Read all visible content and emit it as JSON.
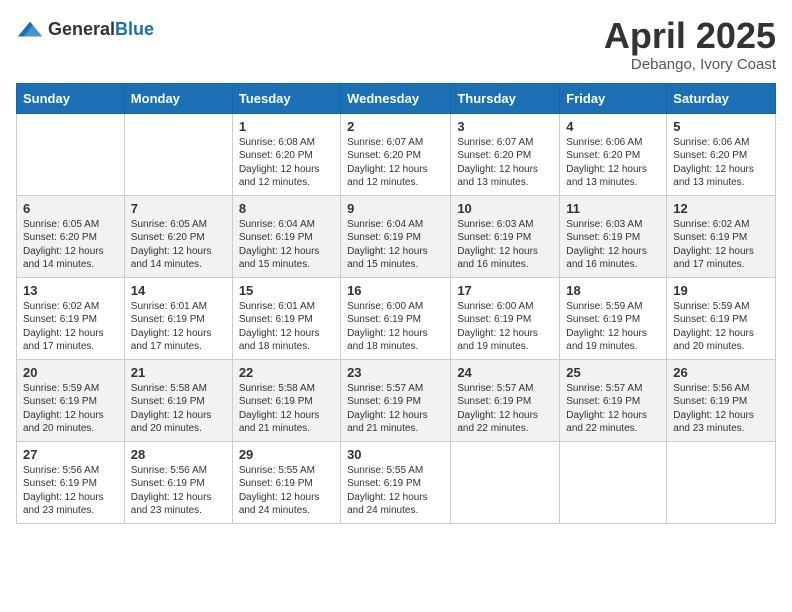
{
  "logo": {
    "general": "General",
    "blue": "Blue"
  },
  "title": "April 2025",
  "location": "Debango, Ivory Coast",
  "days_header": [
    "Sunday",
    "Monday",
    "Tuesday",
    "Wednesday",
    "Thursday",
    "Friday",
    "Saturday"
  ],
  "weeks": [
    [
      {
        "day": "",
        "info": ""
      },
      {
        "day": "",
        "info": ""
      },
      {
        "day": "1",
        "info": "Sunrise: 6:08 AM\nSunset: 6:20 PM\nDaylight: 12 hours and 12 minutes."
      },
      {
        "day": "2",
        "info": "Sunrise: 6:07 AM\nSunset: 6:20 PM\nDaylight: 12 hours and 12 minutes."
      },
      {
        "day": "3",
        "info": "Sunrise: 6:07 AM\nSunset: 6:20 PM\nDaylight: 12 hours and 13 minutes."
      },
      {
        "day": "4",
        "info": "Sunrise: 6:06 AM\nSunset: 6:20 PM\nDaylight: 12 hours and 13 minutes."
      },
      {
        "day": "5",
        "info": "Sunrise: 6:06 AM\nSunset: 6:20 PM\nDaylight: 12 hours and 13 minutes."
      }
    ],
    [
      {
        "day": "6",
        "info": "Sunrise: 6:05 AM\nSunset: 6:20 PM\nDaylight: 12 hours and 14 minutes."
      },
      {
        "day": "7",
        "info": "Sunrise: 6:05 AM\nSunset: 6:20 PM\nDaylight: 12 hours and 14 minutes."
      },
      {
        "day": "8",
        "info": "Sunrise: 6:04 AM\nSunset: 6:19 PM\nDaylight: 12 hours and 15 minutes."
      },
      {
        "day": "9",
        "info": "Sunrise: 6:04 AM\nSunset: 6:19 PM\nDaylight: 12 hours and 15 minutes."
      },
      {
        "day": "10",
        "info": "Sunrise: 6:03 AM\nSunset: 6:19 PM\nDaylight: 12 hours and 16 minutes."
      },
      {
        "day": "11",
        "info": "Sunrise: 6:03 AM\nSunset: 6:19 PM\nDaylight: 12 hours and 16 minutes."
      },
      {
        "day": "12",
        "info": "Sunrise: 6:02 AM\nSunset: 6:19 PM\nDaylight: 12 hours and 17 minutes."
      }
    ],
    [
      {
        "day": "13",
        "info": "Sunrise: 6:02 AM\nSunset: 6:19 PM\nDaylight: 12 hours and 17 minutes."
      },
      {
        "day": "14",
        "info": "Sunrise: 6:01 AM\nSunset: 6:19 PM\nDaylight: 12 hours and 17 minutes."
      },
      {
        "day": "15",
        "info": "Sunrise: 6:01 AM\nSunset: 6:19 PM\nDaylight: 12 hours and 18 minutes."
      },
      {
        "day": "16",
        "info": "Sunrise: 6:00 AM\nSunset: 6:19 PM\nDaylight: 12 hours and 18 minutes."
      },
      {
        "day": "17",
        "info": "Sunrise: 6:00 AM\nSunset: 6:19 PM\nDaylight: 12 hours and 19 minutes."
      },
      {
        "day": "18",
        "info": "Sunrise: 5:59 AM\nSunset: 6:19 PM\nDaylight: 12 hours and 19 minutes."
      },
      {
        "day": "19",
        "info": "Sunrise: 5:59 AM\nSunset: 6:19 PM\nDaylight: 12 hours and 20 minutes."
      }
    ],
    [
      {
        "day": "20",
        "info": "Sunrise: 5:59 AM\nSunset: 6:19 PM\nDaylight: 12 hours and 20 minutes."
      },
      {
        "day": "21",
        "info": "Sunrise: 5:58 AM\nSunset: 6:19 PM\nDaylight: 12 hours and 20 minutes."
      },
      {
        "day": "22",
        "info": "Sunrise: 5:58 AM\nSunset: 6:19 PM\nDaylight: 12 hours and 21 minutes."
      },
      {
        "day": "23",
        "info": "Sunrise: 5:57 AM\nSunset: 6:19 PM\nDaylight: 12 hours and 21 minutes."
      },
      {
        "day": "24",
        "info": "Sunrise: 5:57 AM\nSunset: 6:19 PM\nDaylight: 12 hours and 22 minutes."
      },
      {
        "day": "25",
        "info": "Sunrise: 5:57 AM\nSunset: 6:19 PM\nDaylight: 12 hours and 22 minutes."
      },
      {
        "day": "26",
        "info": "Sunrise: 5:56 AM\nSunset: 6:19 PM\nDaylight: 12 hours and 23 minutes."
      }
    ],
    [
      {
        "day": "27",
        "info": "Sunrise: 5:56 AM\nSunset: 6:19 PM\nDaylight: 12 hours and 23 minutes."
      },
      {
        "day": "28",
        "info": "Sunrise: 5:56 AM\nSunset: 6:19 PM\nDaylight: 12 hours and 23 minutes."
      },
      {
        "day": "29",
        "info": "Sunrise: 5:55 AM\nSunset: 6:19 PM\nDaylight: 12 hours and 24 minutes."
      },
      {
        "day": "30",
        "info": "Sunrise: 5:55 AM\nSunset: 6:19 PM\nDaylight: 12 hours and 24 minutes."
      },
      {
        "day": "",
        "info": ""
      },
      {
        "day": "",
        "info": ""
      },
      {
        "day": "",
        "info": ""
      }
    ]
  ]
}
